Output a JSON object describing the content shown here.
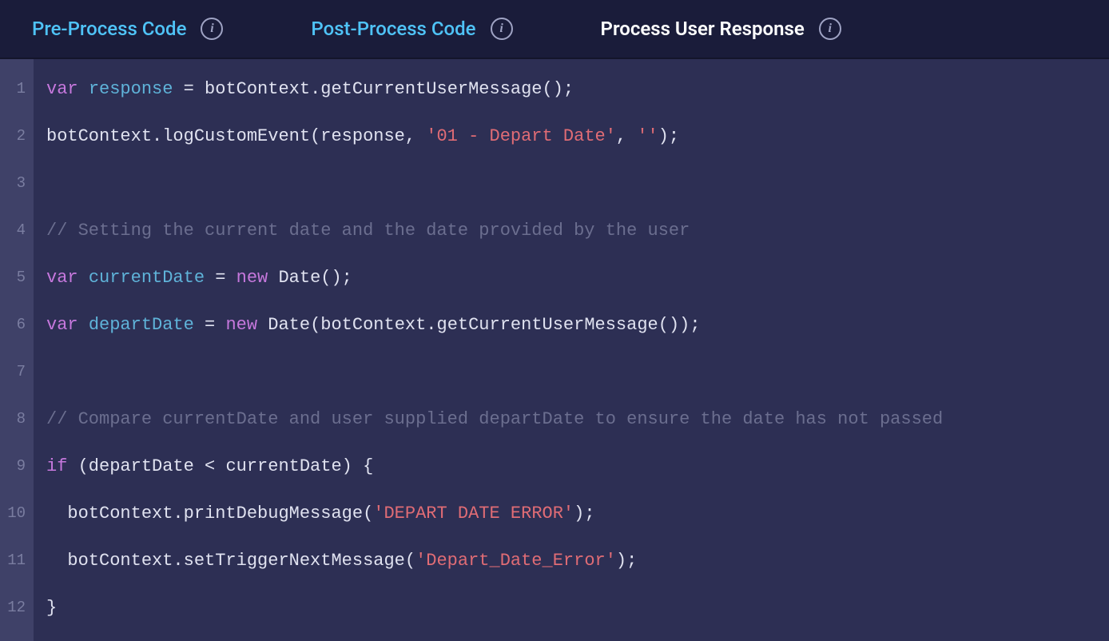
{
  "tabs": {
    "tab1": "Pre-Process Code",
    "tab2": "Post-Process Code",
    "tab3": "Process User Response"
  },
  "lineNumbers": {
    "l1": "1",
    "l2": "2",
    "l3": "3",
    "l4": "4",
    "l5": "5",
    "l6": "6",
    "l7": "7",
    "l8": "8",
    "l9": "9",
    "l10": "10",
    "l11": "11",
    "l12": "12"
  },
  "code": {
    "line1": {
      "t1": "var",
      "t2": " ",
      "t3": "response",
      "t4": " = botContext.getCurrentUserMessage();"
    },
    "line2": {
      "t1": "botContext.logCustomEvent(response, ",
      "t2": "'01 - Depart Date'",
      "t3": ", ",
      "t4": "''",
      "t5": ");"
    },
    "line3": {
      "t1": ""
    },
    "line4": {
      "t1": "// Setting the current date and the date provided by the user"
    },
    "line5": {
      "t1": "var",
      "t2": " ",
      "t3": "currentDate",
      "t4": " = ",
      "t5": "new",
      "t6": " Date();"
    },
    "line6": {
      "t1": "var",
      "t2": " ",
      "t3": "departDate",
      "t4": " = ",
      "t5": "new",
      "t6": " Date(botContext.getCurrentUserMessage());"
    },
    "line7": {
      "t1": ""
    },
    "line8": {
      "t1": "// Compare currentDate and user supplied departDate to ensure the date has not passed"
    },
    "line9": {
      "t1": "if",
      "t2": " (departDate < currentDate) {"
    },
    "line10": {
      "t1": "  botContext.printDebugMessage(",
      "t2": "'DEPART DATE ERROR'",
      "t3": ");"
    },
    "line11": {
      "t1": "  botContext.setTriggerNextMessage(",
      "t2": "'Depart_Date_Error'",
      "t3": ");"
    },
    "line12": {
      "t1": "}"
    }
  }
}
